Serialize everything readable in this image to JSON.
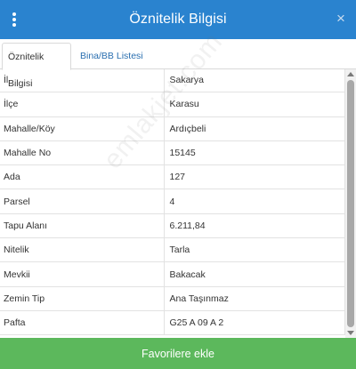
{
  "header": {
    "title": "Öznitelik Bilgisi",
    "menu_icon": "vertical-dots-icon",
    "close_label": "×"
  },
  "tabs": [
    {
      "label": "Öznitelik Bilgisi",
      "active": true
    },
    {
      "label": "Bina/BB Listesi",
      "active": false
    }
  ],
  "attributes": [
    {
      "key": "İl",
      "value": "Sakarya"
    },
    {
      "key": "İlçe",
      "value": "Karasu"
    },
    {
      "key": "Mahalle/Köy",
      "value": "Ardıçbeli"
    },
    {
      "key": "Mahalle No",
      "value": "15145"
    },
    {
      "key": "Ada",
      "value": "127"
    },
    {
      "key": "Parsel",
      "value": "4"
    },
    {
      "key": "Tapu Alanı",
      "value": "6.211,84"
    },
    {
      "key": "Nitelik",
      "value": "Tarla"
    },
    {
      "key": "Mevkii",
      "value": "Bakacak"
    },
    {
      "key": "Zemin Tip",
      "value": "Ana Taşınmaz"
    },
    {
      "key": "Pafta",
      "value": "G25 A 09 A 2"
    }
  ],
  "footer": {
    "button_label": "Favorilere ekle"
  },
  "watermark": "emlakjet.com",
  "colors": {
    "header": "#2a83cf",
    "footer_button": "#5cb85c",
    "tab_link": "#2a6fb0"
  }
}
